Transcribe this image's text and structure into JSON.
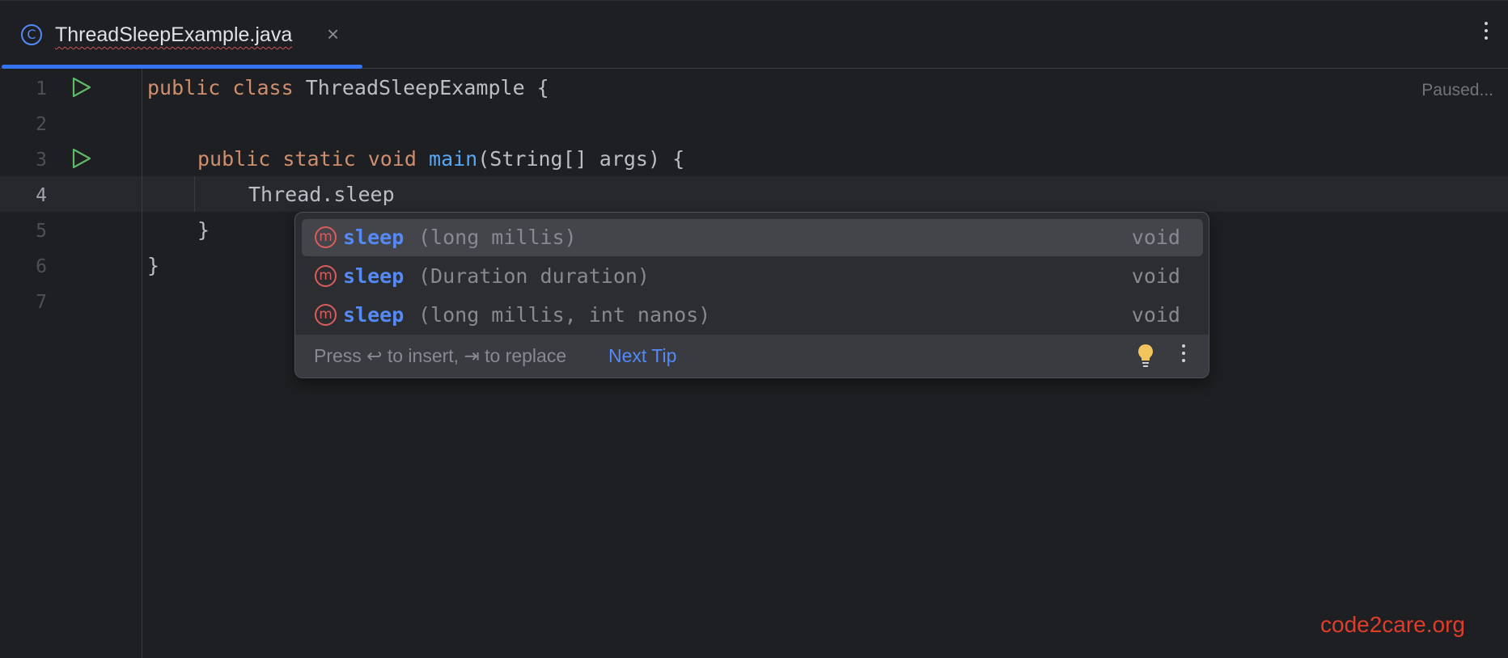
{
  "tab": {
    "icon": "class-c-icon",
    "icon_glyph": "C",
    "title": "ThreadSleepExample.java",
    "close_glyph": "×"
  },
  "editor": {
    "status": "Paused...",
    "line_numbers": [
      "1",
      "2",
      "3",
      "4",
      "5",
      "6",
      "7"
    ],
    "current_line": "4",
    "code": {
      "l1": {
        "kw1": "public",
        "kw2": "class",
        "rest": " ThreadSleepExample {"
      },
      "l3": {
        "kw1": "public",
        "kw2": "static",
        "kw3": "void",
        "fn": "main",
        "rest": "(String[] args) {"
      },
      "l4": {
        "text": "Thread.sleep"
      },
      "l5": {
        "text": "}"
      },
      "l6": {
        "text": "}"
      }
    }
  },
  "completion": {
    "items": [
      {
        "icon_glyph": "m",
        "name": "sleep",
        "params": "(long millis)",
        "type": "void"
      },
      {
        "icon_glyph": "m",
        "name": "sleep",
        "params": "(Duration duration)",
        "type": "void"
      },
      {
        "icon_glyph": "m",
        "name": "sleep",
        "params": "(long millis, int nanos)",
        "type": "void"
      }
    ],
    "hint": "Press ↩ to insert, ⇥ to replace",
    "next_tip": "Next Tip"
  },
  "watermark": "code2care.org",
  "colors": {
    "background": "#1e1f22",
    "accent": "#3574f0",
    "keyword": "#cf8e6d",
    "function": "#56a8f5",
    "method_icon": "#db5c5c",
    "watermark": "#e03c2a"
  }
}
